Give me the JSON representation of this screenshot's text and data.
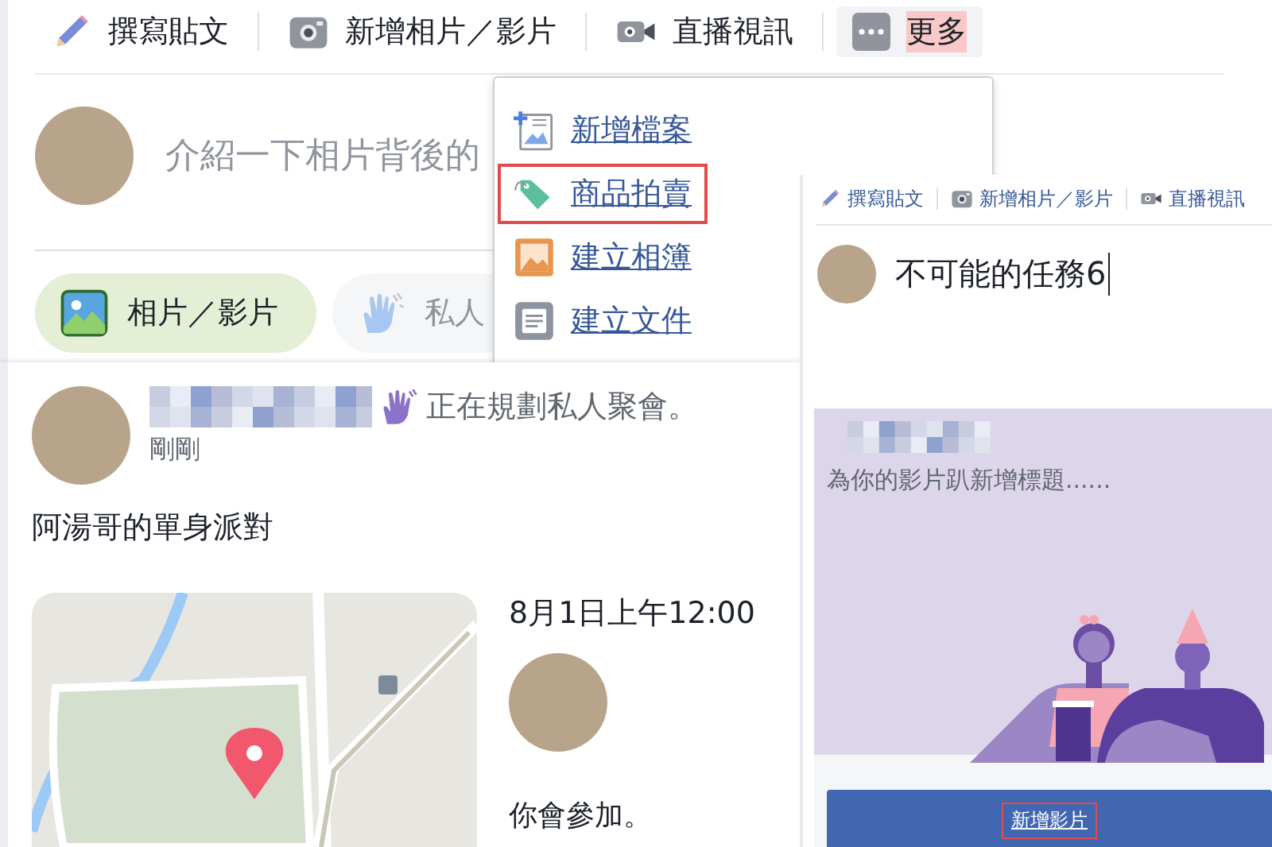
{
  "composer": {
    "tabs": [
      {
        "label": "撰寫貼文",
        "kind": "pencil",
        "selected": false
      },
      {
        "label": "新增相片／影片",
        "kind": "camera",
        "selected": false
      },
      {
        "label": "直播視訊",
        "kind": "video",
        "selected": false
      },
      {
        "label": "更多",
        "kind": "dots",
        "selected": true
      }
    ],
    "placeholder": "介紹一下相片背後的",
    "actions": [
      {
        "label": "相片／影片",
        "kind": "photo",
        "selected": true
      },
      {
        "label": "私人",
        "kind": "hand",
        "selected": false
      }
    ]
  },
  "more_menu": {
    "items": [
      {
        "label": "新增檔案",
        "kind": "file",
        "highlighted": false
      },
      {
        "label": "商品拍賣",
        "kind": "tag",
        "highlighted": true
      },
      {
        "label": "建立相簿",
        "kind": "album",
        "highlighted": false
      },
      {
        "label": "建立文件",
        "kind": "doc",
        "highlighted": false
      }
    ]
  },
  "post": {
    "action": "正在規劃私人聚會。",
    "time": "剛剛",
    "title": "阿湯哥的單身派對",
    "event_time": "8月1日上午12:00",
    "rsvp": "你會參加。"
  },
  "video_composer": {
    "tabs": [
      {
        "label": "撰寫貼文",
        "kind": "pencil"
      },
      {
        "label": "新增相片／影片",
        "kind": "camera"
      },
      {
        "label": "直播視訊",
        "kind": "video"
      }
    ],
    "value": "不可能的任務6",
    "card_prompt": "為你的影片趴新增標題......",
    "button": {
      "label": "新增影片",
      "highlighted": true
    }
  }
}
